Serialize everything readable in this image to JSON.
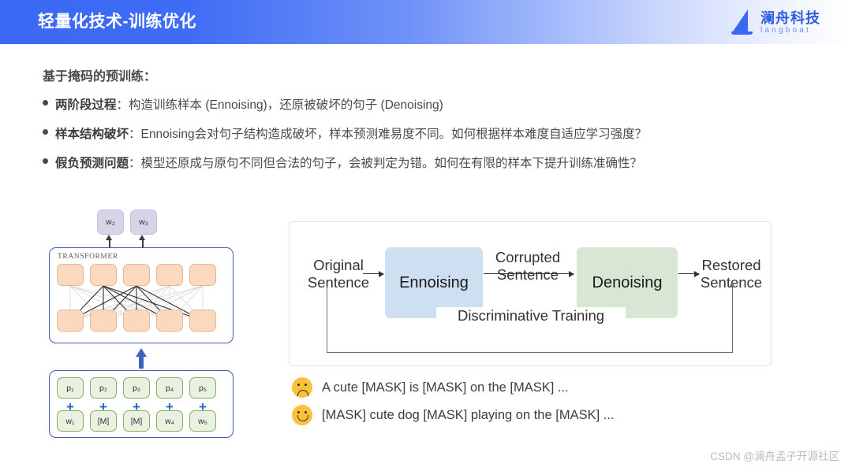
{
  "header": {
    "title": "轻量化技术-训练优化",
    "gradient_start": "#3a68f4",
    "gradient_end": "#ffffff",
    "logo": {
      "cn": "澜舟科技",
      "en": "langboat",
      "color": "#2f5fe0"
    }
  },
  "content": {
    "section_heading": "基于掩码的预训练：",
    "bullets": [
      {
        "lead": "两阶段过程",
        "rest": "：构造训练样本 (Ennoising)，还原被破坏的句子 (Denoising)"
      },
      {
        "lead": "样本结构破坏",
        "rest": "：Ennoising会对句子结构造成破坏，样本预测难易度不同。如何根据样本难度自适应学习强度？"
      },
      {
        "lead": "假负预测问题",
        "rest": "：模型还原成与原句不同但合法的句子，会被判定为错。如何在有限的样本下提升训练准确性？"
      }
    ]
  },
  "left_figure": {
    "model_label": "TRANSFORMER",
    "output_tokens": [
      "w₂",
      "w₃"
    ],
    "position_tokens": [
      "p₁",
      "p₂",
      "p₃",
      "p₄",
      "p₅"
    ],
    "plus_symbols": [
      "+",
      "+",
      "+",
      "+",
      "+"
    ],
    "input_tokens": [
      "w₁",
      "[M]",
      "[M]",
      "w₄",
      "w₅"
    ],
    "colors": {
      "output_box": "#d6d4e8",
      "hidden_cell": "#fbd9bf",
      "hidden_cell_border": "#e8b491",
      "input_cell": "#e9f2e1",
      "input_cell_border": "#82ae63",
      "panel_border": "#3e5fa8",
      "arrow": "#3e62c0"
    }
  },
  "flow_diagram": {
    "nodes": [
      {
        "id": "original",
        "label_line1": "Original",
        "label_line2": "Sentence",
        "kind": "text"
      },
      {
        "id": "ennoising",
        "label": "Ennoising",
        "kind": "box",
        "color": "#cddff0"
      },
      {
        "id": "corrupted",
        "label_line1": "Corrupted",
        "label_line2": "Sentence",
        "kind": "text"
      },
      {
        "id": "denoising",
        "label": "Denoising",
        "kind": "box",
        "color": "#d7e7d3"
      },
      {
        "id": "restored",
        "label_line1": "Restored",
        "label_line2": "Sentence",
        "kind": "text"
      }
    ],
    "feedback_label": "Discriminative Training"
  },
  "examples": [
    {
      "sentiment": "sad",
      "emoji_name": "frowning-face-emoji",
      "text": "A cute [MASK] is [MASK] on the [MASK] ...",
      "color": "#fbc13c"
    },
    {
      "sentiment": "happy",
      "emoji_name": "smiling-face-emoji",
      "text": "[MASK] cute dog [MASK]  playing on the [MASK] ...",
      "color": "#fbc13c"
    }
  ],
  "watermark": "CSDN @澜舟孟子开源社区"
}
